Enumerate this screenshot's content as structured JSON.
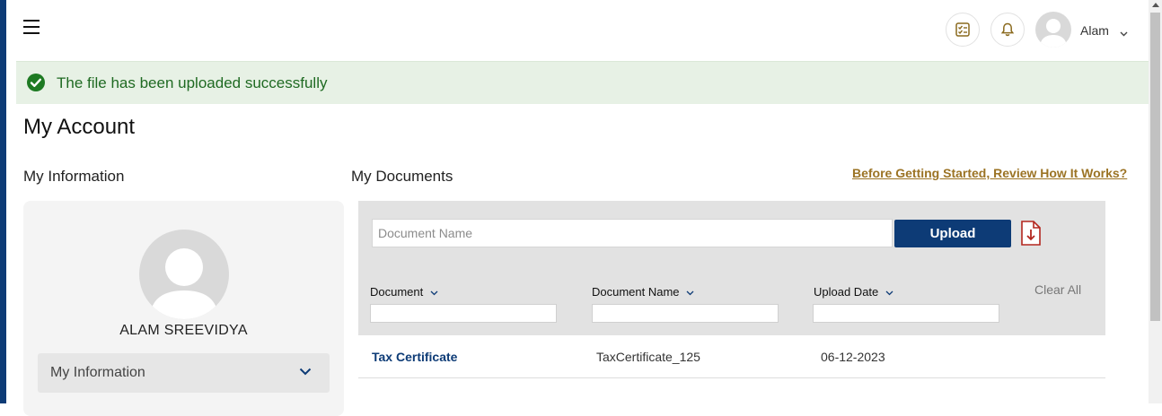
{
  "header": {
    "user_name": "Alam",
    "icons": [
      "menu-icon",
      "checklist-icon",
      "bell-icon",
      "user-avatar",
      "chevron-down-icon"
    ]
  },
  "alert": {
    "message": "The file has been uploaded successfully",
    "color": "#1f6a22"
  },
  "page": {
    "title": "My Account"
  },
  "my_information": {
    "section_title": "My Information",
    "name": "ALAM SREEVIDYA",
    "accordion_label": "My Information"
  },
  "my_documents": {
    "section_title": "My Documents",
    "help_link": "Before Getting Started, Review How It Works?",
    "document_name_placeholder": "Document Name",
    "upload_label": "Upload",
    "columns": [
      "Document",
      "Document Name",
      "Upload Date"
    ],
    "clear_all": "Clear All",
    "rows": [
      {
        "document": "Tax Certificate",
        "document_name": "TaxCertificate_125",
        "upload_date": "06-12-2023"
      }
    ]
  },
  "colors": {
    "brand": "#0d3b76",
    "accent": "#9b7324",
    "alert_bg": "#e7f1e5"
  }
}
